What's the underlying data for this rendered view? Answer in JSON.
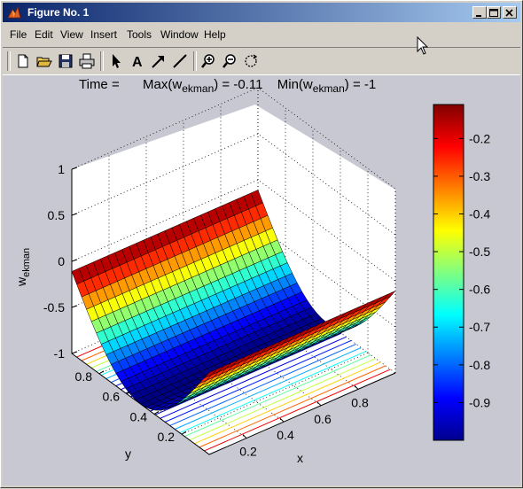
{
  "window": {
    "title": "Figure No. 1",
    "controls": {
      "minimize": "_",
      "maximize": "□",
      "close": "×"
    }
  },
  "menu": [
    "File",
    "Edit",
    "View",
    "Insert",
    "Tools",
    "Window",
    "Help"
  ],
  "toolbar": {
    "tools": [
      "new-file-icon",
      "open-folder-icon",
      "save-icon",
      "print-icon",
      "select-arrow-icon",
      "insert-text-icon",
      "insert-arrow-icon",
      "insert-line-icon",
      "zoom-in-icon",
      "zoom-out-icon",
      "rotate-3d-icon"
    ],
    "text_tool_glyph": "A"
  },
  "plot": {
    "title_time": "Time =",
    "title_max_prefix": "Max(w",
    "title_max_sub": "ekman",
    "title_max_value": ") = -0.11",
    "title_min_prefix": "Min(w",
    "title_min_sub": "ekman",
    "title_min_value": ") = -1",
    "zlabel_main": "w",
    "zlabel_sub": "ekman",
    "xlabel": "x",
    "ylabel": "y",
    "z_ticks": [
      "1",
      "0.5",
      "0",
      "-0.5",
      "-1"
    ],
    "y_ticks": [
      "0.8",
      "0.6",
      "0.4",
      "0.2"
    ],
    "x_ticks": [
      "0.2",
      "0.4",
      "0.6",
      "0.8"
    ],
    "colorbar_ticks": [
      "-0.2",
      "-0.3",
      "-0.4",
      "-0.5",
      "-0.6",
      "-0.7",
      "-0.8",
      "-0.9"
    ]
  },
  "colors": {
    "titlebar_start": "#0a246a",
    "titlebar_end": "#a6caf0",
    "figure_bg": "#c8c8d2",
    "axes_bg": "#ffffff"
  },
  "chart_data": {
    "type": "surface",
    "zlabel": "wekman",
    "xlabel": "x",
    "ylabel": "y",
    "zlim": [
      -1,
      1
    ],
    "xlim": [
      0,
      1
    ],
    "ylim": [
      0,
      1
    ],
    "colormap": "jet",
    "colorbar_range": [
      -1,
      -0.11
    ],
    "grid": true,
    "series": [
      {
        "name": "surface",
        "description_values": {
          "z_at_y_edges": -0.11,
          "z_minimum": -1
        }
      }
    ]
  }
}
